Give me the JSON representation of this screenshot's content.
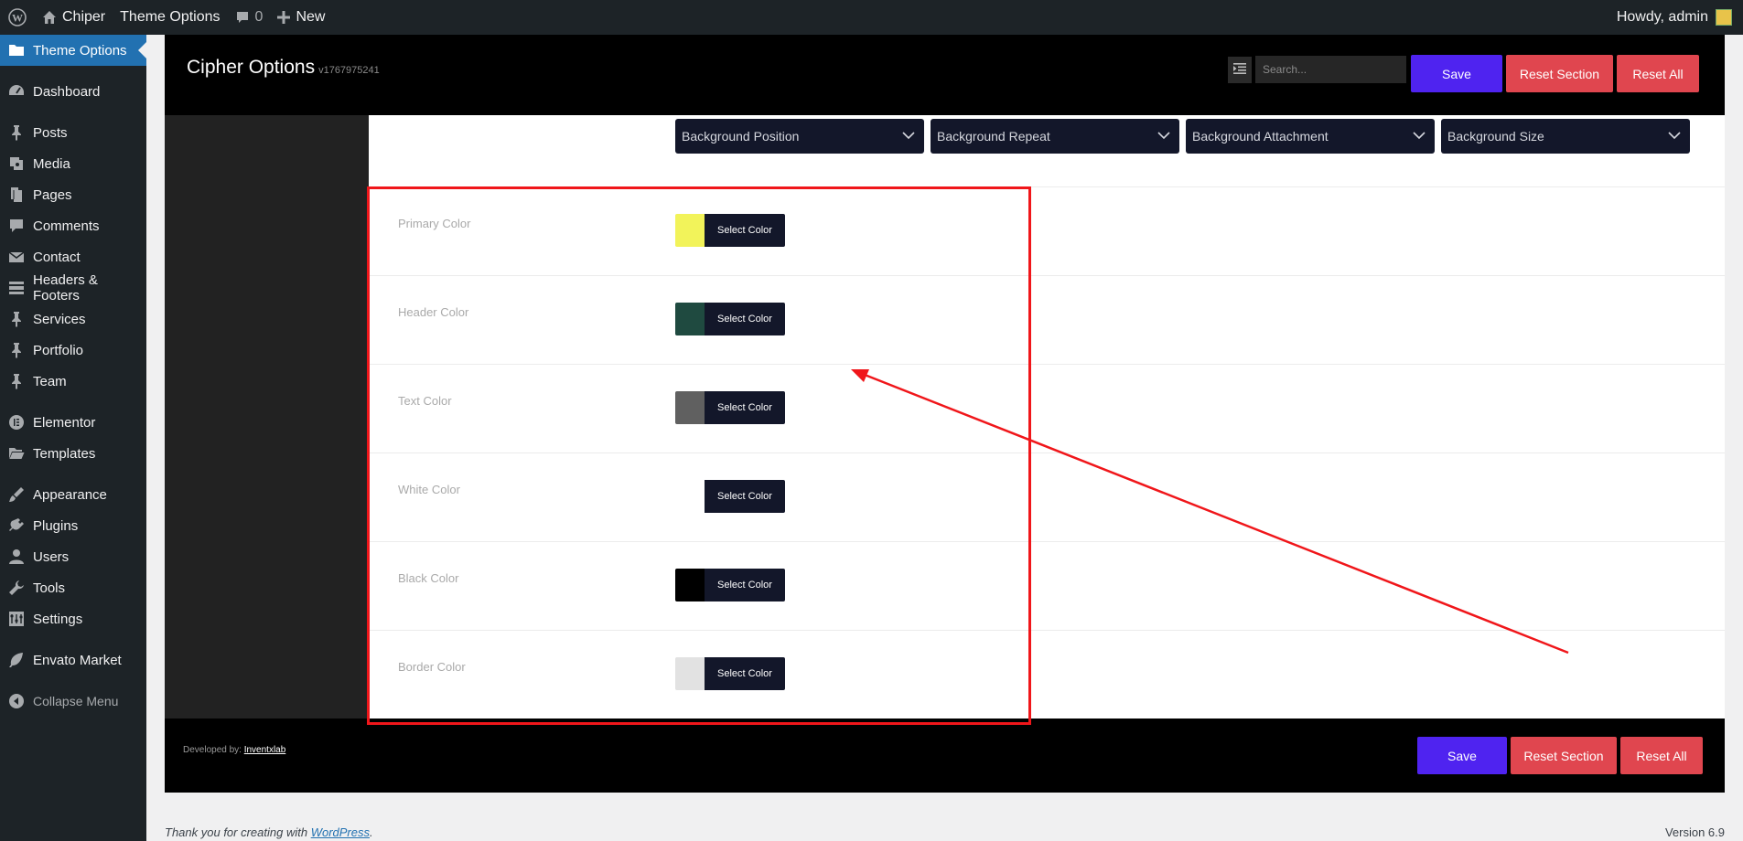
{
  "admin_bar": {
    "site_name": "Chiper",
    "theme_options": "Theme Options",
    "comments_count": "0",
    "new_label": "New",
    "greeting": "Howdy, admin"
  },
  "sidebar": {
    "items": [
      {
        "label": "Theme Options",
        "icon": "folder-icon"
      },
      {
        "label": "Dashboard",
        "icon": "dashboard-icon"
      },
      {
        "label": "Posts",
        "icon": "pin-icon"
      },
      {
        "label": "Media",
        "icon": "media-icon"
      },
      {
        "label": "Pages",
        "icon": "pages-icon"
      },
      {
        "label": "Comments",
        "icon": "comment-icon"
      },
      {
        "label": "Contact",
        "icon": "mail-icon"
      },
      {
        "label": "Headers & Footers",
        "icon": "layout-icon"
      },
      {
        "label": "Services",
        "icon": "pin-icon"
      },
      {
        "label": "Portfolio",
        "icon": "pin-icon"
      },
      {
        "label": "Team",
        "icon": "pin-icon"
      },
      {
        "label": "Elementor",
        "icon": "elementor-icon"
      },
      {
        "label": "Templates",
        "icon": "folder-open-icon"
      },
      {
        "label": "Appearance",
        "icon": "brush-icon"
      },
      {
        "label": "Plugins",
        "icon": "plug-icon"
      },
      {
        "label": "Users",
        "icon": "user-icon"
      },
      {
        "label": "Tools",
        "icon": "wrench-icon"
      },
      {
        "label": "Settings",
        "icon": "settings-icon"
      },
      {
        "label": "Envato Market",
        "icon": "leaf-icon"
      },
      {
        "label": "Collapse Menu",
        "icon": "collapse-icon"
      }
    ]
  },
  "panel": {
    "title": "Cipher Options",
    "version": "v1767975241",
    "search_placeholder": "Search...",
    "save": "Save",
    "reset_section": "Reset Section",
    "reset_all": "Reset All"
  },
  "background_selects": [
    "Background Position",
    "Background Repeat",
    "Background Attachment",
    "Background Size"
  ],
  "color_fields": [
    {
      "label": "Primary Color",
      "color": "#f2f35a",
      "button": "Select Color"
    },
    {
      "label": "Header Color",
      "color": "#1f4a40",
      "button": "Select Color"
    },
    {
      "label": "Text Color",
      "color": "#606060",
      "button": "Select Color"
    },
    {
      "label": "White Color",
      "color": "#ffffff",
      "button": "Select Color"
    },
    {
      "label": "Black Color",
      "color": "#000000",
      "button": "Select Color"
    },
    {
      "label": "Border Color",
      "color": "#e2e2e2",
      "button": "Select Color"
    }
  ],
  "footer": {
    "developed_by": "Developed by:",
    "developer": "Inventxlab",
    "save": "Save",
    "reset_section": "Reset Section",
    "reset_all": "Reset All"
  },
  "wp_footer": {
    "thanks_prefix": "Thank you for creating with",
    "wordpress": "WordPress",
    "thanks_suffix": ".",
    "version": "Version 6.9"
  },
  "colors": {
    "accent_blue": "#2271b1",
    "save_purple": "#4f23f0",
    "reset_red": "#e0464f",
    "annotation_red": "#f0161a"
  }
}
